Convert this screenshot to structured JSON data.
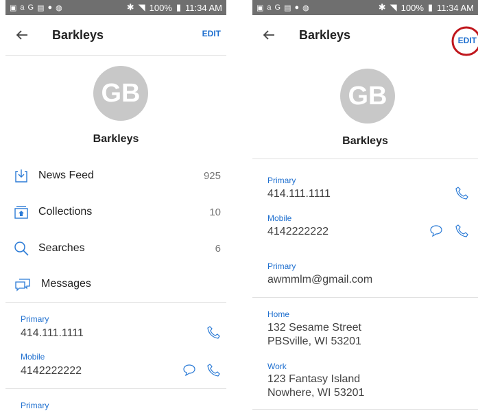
{
  "status_bar": {
    "battery": "100%",
    "time": "11:34 AM"
  },
  "left": {
    "title": "Barkleys",
    "edit_label": "EDIT",
    "avatar_initials": "GB",
    "name": "Barkleys",
    "menu": [
      {
        "label": "News Feed",
        "count": "925",
        "icon": "news-feed-icon"
      },
      {
        "label": "Collections",
        "count": "10",
        "icon": "collections-icon"
      },
      {
        "label": "Searches",
        "count": "6",
        "icon": "search-icon"
      },
      {
        "label": "Messages",
        "count": "",
        "icon": "messages-icon"
      }
    ],
    "phones": [
      {
        "type": "Primary",
        "number": "414.111.1111"
      },
      {
        "type": "Mobile",
        "number": "4142222222"
      }
    ],
    "email_type": "Primary"
  },
  "right": {
    "title": "Barkleys",
    "edit_label": "EDIT",
    "avatar_initials": "GB",
    "name": "Barkleys",
    "phones": [
      {
        "type": "Primary",
        "number": "414.111.1111"
      },
      {
        "type": "Mobile",
        "number": "4142222222"
      }
    ],
    "email": {
      "type": "Primary",
      "address": "awmmlm@gmail.com"
    },
    "addresses": [
      {
        "type": "Home",
        "line1": "132 Sesame Street",
        "line2": "PBSville, WI 53201"
      },
      {
        "type": "Work",
        "line1": "123 Fantasy Island",
        "line2": "Nowhere, WI 53201"
      }
    ],
    "highlight_color": "#c0171d"
  },
  "colors": {
    "accent": "#1e6fcf",
    "status_bar": "#6f6f6f",
    "avatar": "#c8c8c8"
  }
}
